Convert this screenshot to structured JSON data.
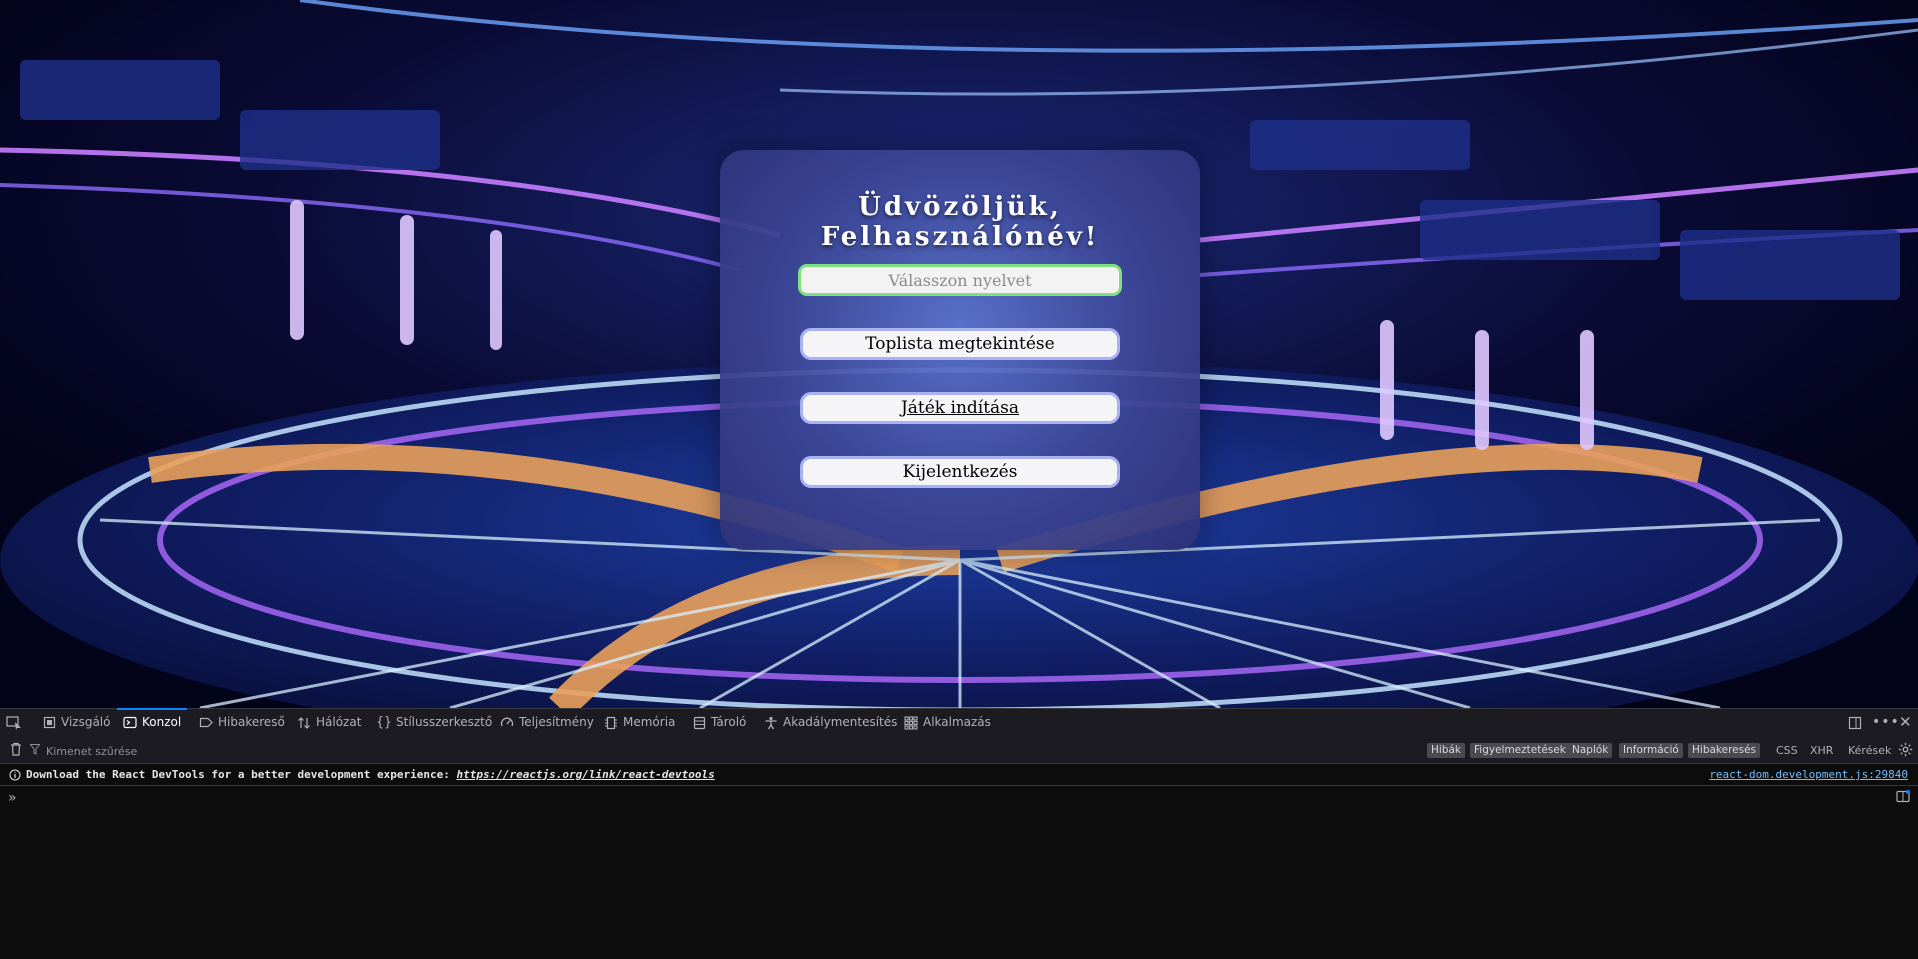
{
  "welcome": {
    "title": "Üdvözöljük, Felhasználónév!",
    "language_placeholder": "Válasszon nyelvet",
    "leaderboard_button": "Toplista megtekintése",
    "start_button": "Játék indítása",
    "logout_button": "Kijelentkezés"
  },
  "devtools": {
    "tabs": [
      {
        "label": "Vizsgáló",
        "icon": "inspector-icon"
      },
      {
        "label": "Konzol",
        "icon": "console-icon"
      },
      {
        "label": "Hibakereső",
        "icon": "debugger-icon"
      },
      {
        "label": "Hálózat",
        "icon": "network-icon"
      },
      {
        "label": "Stílusszerkesztő",
        "icon": "style-editor-icon"
      },
      {
        "label": "Teljesítmény",
        "icon": "performance-icon"
      },
      {
        "label": "Memória",
        "icon": "memory-icon"
      },
      {
        "label": "Tároló",
        "icon": "storage-icon"
      },
      {
        "label": "Akadálymentesítés",
        "icon": "accessibility-icon"
      },
      {
        "label": "Alkalmazás",
        "icon": "application-icon"
      }
    ],
    "active_tab": "Konzol",
    "filter_placeholder": "Kimenet szűrése",
    "filters": [
      "Hibák",
      "Figyelmeztetések",
      "Naplók",
      "Információ",
      "Hibakeresés"
    ],
    "plain_filters": [
      "CSS",
      "XHR",
      "Kérések"
    ],
    "message": {
      "text": "Download the React DevTools for a better development experience: ",
      "link": "https://reactjs.org/link/react-devtools",
      "source": "react-dom.development.js:29840"
    },
    "accent": "#0a84ff"
  }
}
